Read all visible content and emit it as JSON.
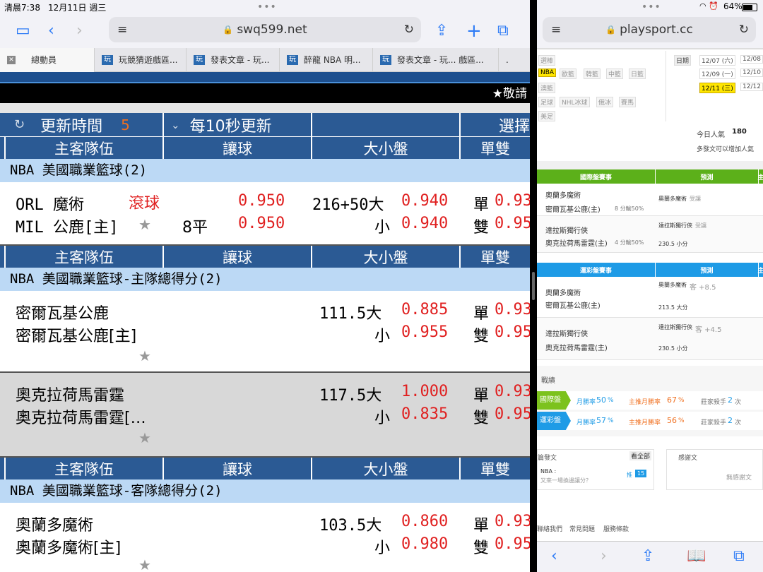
{
  "left": {
    "status": {
      "time": "清晨7:38",
      "date": "12月11日 週三"
    },
    "url": "swq599.net",
    "tabs": [
      {
        "label": "總動員"
      },
      {
        "label": "玩競猜遊戲區..."
      },
      {
        "label": "發表文章 - 玩..."
      },
      {
        "label": "醉龍 NBA 明..."
      },
      {
        "label": "發表文章 - 玩... 戲區..."
      },
      {
        "label": "."
      }
    ],
    "banner": "★敬請",
    "controls": {
      "refresh_label": "更新時間",
      "countdown": "5",
      "interval": "每10秒更新",
      "select": "選擇"
    },
    "headers": {
      "team": "主客隊伍",
      "handicap": "讓球",
      "ou": "大小盤",
      "oe": "單雙"
    },
    "sections": [
      {
        "title": "NBA 美國職業籃球(2)"
      },
      {
        "title": "NBA 美國職業籃球-主隊總得分(2)"
      },
      {
        "title": "NBA 美國職業籃球-客隊總得分(2)"
      }
    ],
    "games": [
      {
        "away": "ORL 魔術",
        "live": "滾球",
        "home": "MIL 公鹿[主]",
        "line": "8平",
        "hcap1": "0.950",
        "hcap2": "0.950",
        "ou_line": "216+50大",
        "ou_small": "小",
        "ou1": "0.940",
        "ou2": "0.940",
        "odd": "單",
        "even": "雙",
        "oe1": "0.93",
        "oe2": "0.95"
      },
      {
        "away": "密爾瓦基公鹿",
        "home": "密爾瓦基公鹿[主]",
        "ou_line": "111.5大",
        "ou_small": "小",
        "ou1": "0.885",
        "ou2": "0.955",
        "odd": "單",
        "even": "雙",
        "oe1": "0.93",
        "oe2": "0.95"
      },
      {
        "away": "奧克拉荷馬雷霆",
        "home": "奧克拉荷馬雷霆[…",
        "ou_line": "117.5大",
        "ou_small": "小",
        "ou1": "1.000",
        "ou2": "0.835",
        "odd": "單",
        "even": "雙",
        "oe1": "0.93",
        "oe2": "0.95"
      },
      {
        "away": "奧蘭多魔術",
        "home": "奧蘭多魔術[主]",
        "ou_line": "103.5大",
        "ou_small": "小",
        "ou1": "0.860",
        "ou2": "0.980",
        "odd": "單",
        "even": "雙",
        "oe1": "0.93",
        "oe2": "0.95"
      }
    ]
  },
  "right": {
    "status": {
      "battery": "64%"
    },
    "url": "playsport.cc",
    "sports": {
      "row1": "選棒",
      "nba": "NBA",
      "row2": [
        "歐籃",
        "韓籃",
        "中籃",
        "日籃"
      ],
      "row3": "澳籃",
      "row4": [
        "足球",
        "NHL冰球",
        "俄冰",
        "賽馬"
      ],
      "row5": "美足"
    },
    "dates": {
      "label": "日期",
      "d1": "12/07 (六)",
      "d2": "12/08",
      "d3": "12/09 (一)",
      "d4": "12/10",
      "d5": "12/11 (三)",
      "d6": "12/12"
    },
    "popularity": {
      "label": "今日人氣",
      "value": "180",
      "note": "多發文可以增加人氣"
    },
    "intl": {
      "header": "國際盤賽事",
      "pred": "預測",
      "extra": "主",
      "games": [
        {
          "t1": "奧蘭多魔術",
          "t2": "密爾瓦基公鹿(主)",
          "meta": "8 分輸50%",
          "pick": "奧蘭多魔術",
          "pick_state": "受讓"
        },
        {
          "t1": "達拉斯獨行俠",
          "t2": "奧克拉荷馬雷霆(主)",
          "meta": "4 分輸50%",
          "pick": "達拉斯獨行俠",
          "pick_state": "受讓",
          "ou": "230.5 小分"
        }
      ]
    },
    "lottery": {
      "header": "運彩盤賽事",
      "pred": "預測",
      "extra": "主",
      "games": [
        {
          "t1": "奧蘭多魔術",
          "t2": "密爾瓦基公鹿(主)",
          "pick": "奧蘭多魔術",
          "pick_state": "客 +8.5",
          "ou": "213.5 大分"
        },
        {
          "t1": "達拉斯獨行俠",
          "t2": "奧克拉荷馬雷霆(主)",
          "pick": "達拉斯獨行俠",
          "pick_state": "客 +4.5",
          "ou": "230.5 小分"
        }
      ]
    },
    "record": {
      "title": "戰績",
      "rows": [
        {
          "label": "國際盤",
          "color": "#7cc21d",
          "win_label": "月勝率",
          "win": "50",
          "home_label": "主推月勝率",
          "home": "67",
          "pct": "%",
          "streak_label": "莊家殺手",
          "streak": "2",
          "unit": "次"
        },
        {
          "label": "運彩盤",
          "color": "#1e9be6",
          "win_label": "月勝率",
          "win": "57",
          "home_label": "主推月勝率",
          "home": "56",
          "pct": "%",
          "streak_label": "莊家殺手",
          "streak": "2",
          "unit": "次"
        }
      ]
    },
    "posts": {
      "title": "篇發文",
      "view_all": "看全部",
      "item_tag": "NBA :",
      "item_text": "又來一場換邊讓分？",
      "push": "推",
      "push_count": "15",
      "thanks_title": "感謝文",
      "thanks_empty": "無感謝文"
    },
    "footer": {
      "contact": "聯絡我們",
      "faq": "常見問題",
      "terms": "服務條款"
    }
  }
}
